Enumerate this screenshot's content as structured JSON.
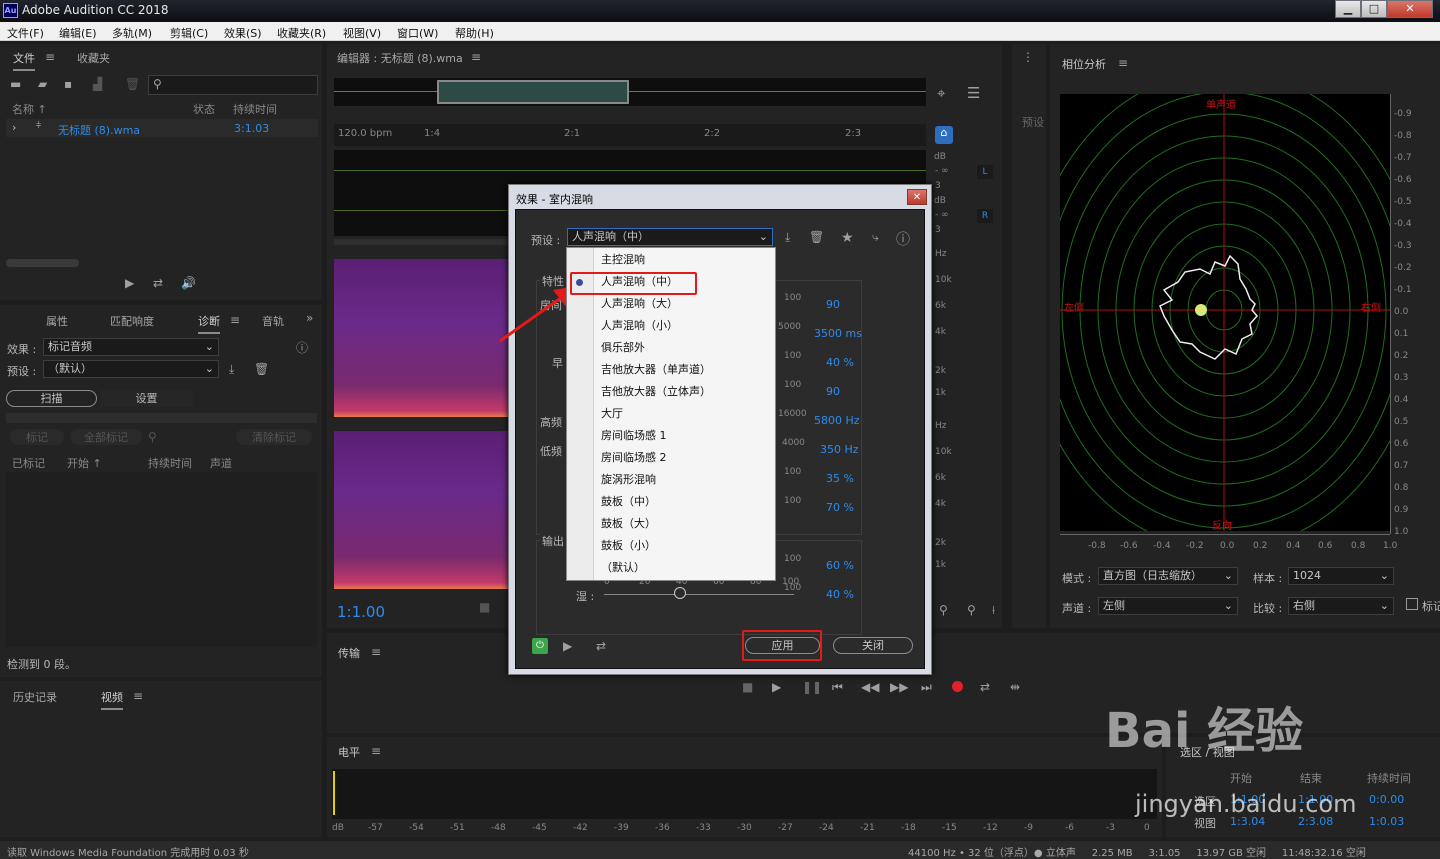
{
  "titlebar": {
    "app_icon": "Au",
    "title": "Adobe Audition CC 2018",
    "min": "▁",
    "max": "□",
    "close": "✕"
  },
  "menu": [
    "文件(F)",
    "编辑(E)",
    "多轨(M)",
    "剪辑(C)",
    "效果(S)",
    "收藏夹(R)",
    "视图(V)",
    "窗口(W)",
    "帮助(H)"
  ],
  "files": {
    "tab1": "文件",
    "tab2": "收藏夹",
    "col_name": "名称 ↑",
    "col_status": "状态",
    "col_duration": "持续时间",
    "item_name": "无标题 (8).wma",
    "item_duration": "3:1.03"
  },
  "diag": {
    "tabs": [
      "属性",
      "匹配响度",
      "诊断",
      "音轨"
    ],
    "effect_label": "效果 :",
    "effect_value": "标记音频",
    "preset_label": "预设 :",
    "preset_value": "（默认）",
    "scan": "扫描",
    "settings": "设置",
    "mark": "标记",
    "mark_all": "全部标记",
    "clear_marks": "清除标记",
    "col_marked": "已标记",
    "col_start": "开始 ↑",
    "col_duration": "持续时间",
    "col_channel": "声道",
    "footer": "检测到 0 段。"
  },
  "history": {
    "tab1": "历史记录",
    "tab2": "视频"
  },
  "editor": {
    "title": "编辑器 : 无标题 (8).wma",
    "bpm": "120.0 bpm",
    "ruler": [
      "1:4",
      "2:1",
      "2:2",
      "2:3"
    ],
    "timecode": "1:1.00",
    "db_label": "dB",
    "db_vals": [
      "- ∞",
      "3",
      "dB",
      "- ∞",
      "3"
    ],
    "hz_top": [
      "Hz",
      "10k",
      "6k",
      "4k",
      "2k",
      "1k"
    ],
    "hz_bottom": [
      "Hz",
      "10k",
      "6k",
      "4k",
      "2k",
      "1k"
    ],
    "L": "L",
    "R": "R",
    "side_tab": "预设"
  },
  "dialog": {
    "title": "效果 - 室内混响",
    "preset_label": "预设 :",
    "preset_value": "人声混响（中）",
    "section1": "特性",
    "section2": "输出",
    "left_labels": [
      "房间",
      "早",
      "高频",
      "低频"
    ],
    "rows": [
      {
        "scale": "100",
        "value": "90"
      },
      {
        "scale": "5000",
        "value": "3500 ms"
      },
      {
        "scale": "100",
        "value": "40 %"
      },
      {
        "scale": "100",
        "value": "90"
      },
      {
        "scale": "16000",
        "value": "5800 Hz"
      },
      {
        "scale": "4000",
        "value": "350 Hz"
      },
      {
        "scale": "100",
        "value": "35 %"
      },
      {
        "scale": "100",
        "value": "70 %"
      },
      {
        "scale": "100",
        "value": "60 %"
      },
      {
        "scale": "100",
        "value": "40 %"
      }
    ],
    "wet_label": "湿 :",
    "wet_ticks": [
      "0",
      "20",
      "40",
      "60",
      "80",
      "100"
    ],
    "apply": "应用",
    "close": "关闭"
  },
  "dropdown": {
    "items": [
      "主控混响",
      "人声混响（中）",
      "人声混响（大）",
      "人声混响（小）",
      "俱乐部外",
      "吉他放大器（单声道）",
      "吉他放大器（立体声）",
      "大厅",
      "房间临场感 1",
      "房间临场感 2",
      "旋涡形混响",
      "鼓板（中）",
      "鼓板（大）",
      "鼓板（小）",
      "（默认）"
    ],
    "selected_index": 1
  },
  "transport": {
    "title": "传输"
  },
  "level": {
    "title": "电平",
    "scale": [
      "dB",
      "-57",
      "-54",
      "-51",
      "-48",
      "-45",
      "-42",
      "-39",
      "-36",
      "-33",
      "-30",
      "-27",
      "-24",
      "-21",
      "-18",
      "-15",
      "-12",
      "-9",
      "-6",
      "-3",
      "0"
    ]
  },
  "selection": {
    "title": "选区 / 视图",
    "col_start": "开始",
    "col_end": "结束",
    "col_duration": "持续时间",
    "row1_label": "选区",
    "row1": [
      "1:1.00",
      "1:1.00",
      "0:0.00"
    ],
    "row2_label": "视图",
    "row2": [
      "1:3.04",
      "2:3.08",
      "1:0.03"
    ]
  },
  "phase": {
    "title": "相位分析",
    "top": "单声道",
    "bottom": "反向",
    "left": "左侧",
    "right": "右侧",
    "y_ticks": [
      "-0.9",
      "-0.8",
      "-0.7",
      "-0.6",
      "-0.5",
      "-0.4",
      "-0.3",
      "-0.2",
      "-0.1",
      "0.0",
      "0.1",
      "0.2",
      "0.3",
      "0.4",
      "0.5",
      "0.6",
      "0.7",
      "0.8",
      "0.9",
      "1.0"
    ],
    "x_ticks": [
      "-0.8",
      "-0.6",
      "-0.4",
      "-0.2",
      "0.0",
      "0.2",
      "0.4",
      "0.6",
      "0.8",
      "1.0"
    ],
    "mode_label": "模式 :",
    "mode_value": "直方图（日志缩放）",
    "sample_label": "样本 :",
    "sample_value": "1024",
    "channel_label": "声道 :",
    "channel_value": "左侧",
    "compare_label": "比较 :",
    "compare_value": "右侧",
    "check_label": "标记"
  },
  "status": {
    "left": "读取 Windows Media Foundation 完成用时 0.03 秒",
    "right": "44100 Hz • 32 位（浮点）● 立体声     2.25 MB     3:1.05     13.97 GB 空闲     11:48:32.16 空闲"
  },
  "watermark": {
    "text": "Bai  经验",
    "url": "jingyan.baidu.com"
  }
}
